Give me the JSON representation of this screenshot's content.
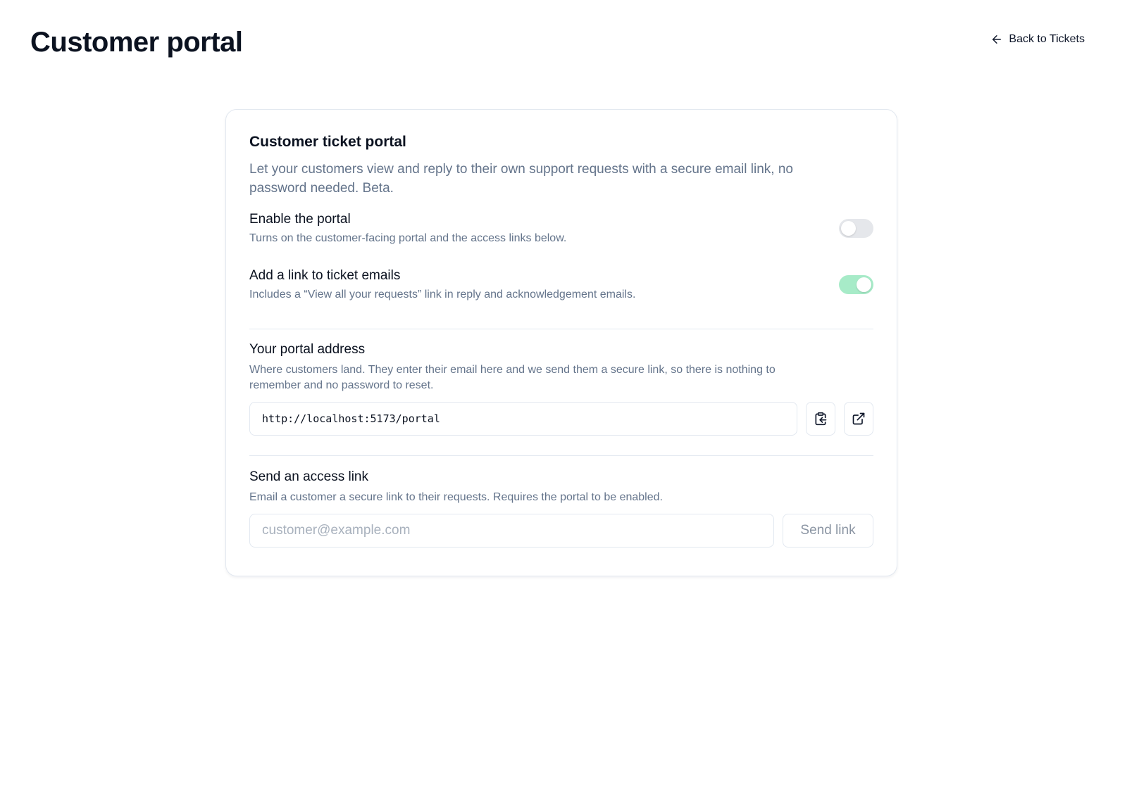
{
  "page": {
    "title": "Customer portal",
    "back_link": {
      "label": "Back to Tickets",
      "icon": "arrow-left-icon"
    }
  },
  "card": {
    "title": "Customer ticket portal",
    "description": "Let your customers view and reply to their own support requests with a secure email link, no password needed. Beta.",
    "settings": [
      {
        "title": "Enable the portal",
        "subtitle": "Turns on the customer-facing portal and the access links below.",
        "enabled": false
      },
      {
        "title": "Add a link to ticket emails",
        "subtitle": "Includes a “View all your requests” link in reply and acknowledgement emails.",
        "enabled": true
      }
    ],
    "portal_address": {
      "title": "Your portal address",
      "subtitle": "Where customers land. They enter their email here and we send them a secure link, so there is nothing to remember and no password to reset.",
      "url": "http://localhost:5173/portal",
      "copy_icon": "clipboard-copy-icon",
      "open_icon": "external-link-icon"
    },
    "access_link": {
      "title": "Send an access link",
      "subtitle": "Email a customer a secure link to their requests. Requires the portal to be enabled.",
      "email_placeholder": "customer@example.com",
      "email_value": "",
      "send_label": "Send link"
    }
  },
  "colors": {
    "toggle_on": "#a7ebc8",
    "toggle_off": "#e5e7eb",
    "muted_text": "#64748b",
    "border": "#e2e8f0"
  }
}
